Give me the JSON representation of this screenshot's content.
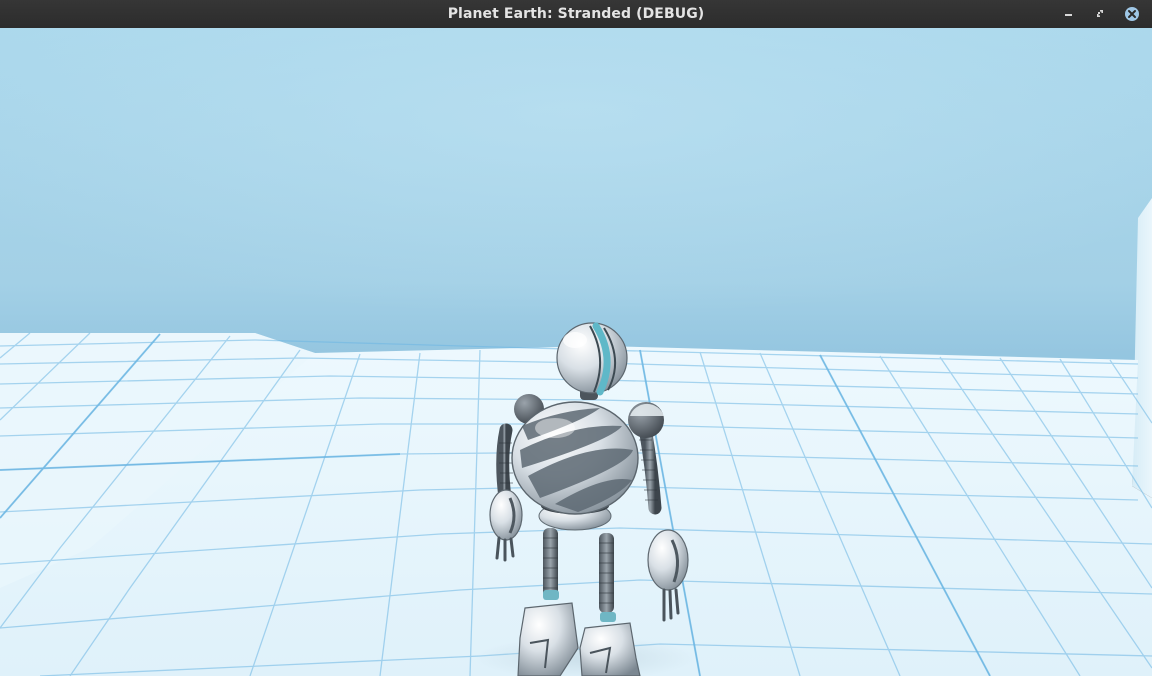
{
  "window": {
    "title": "Planet Earth: Stranded (DEBUG)",
    "controls": {
      "minimize_icon": "minimize-icon",
      "restore_icon": "restore-icon",
      "close_icon": "close-icon"
    }
  },
  "scene": {
    "sky_color": "#a6d3e8",
    "floor_color": "#e3f3fb",
    "grid_line_color": "#5aaee0",
    "character": "robot",
    "robot_accent_color": "#5fb8c8",
    "close_button_color": "#9fc7e6"
  }
}
